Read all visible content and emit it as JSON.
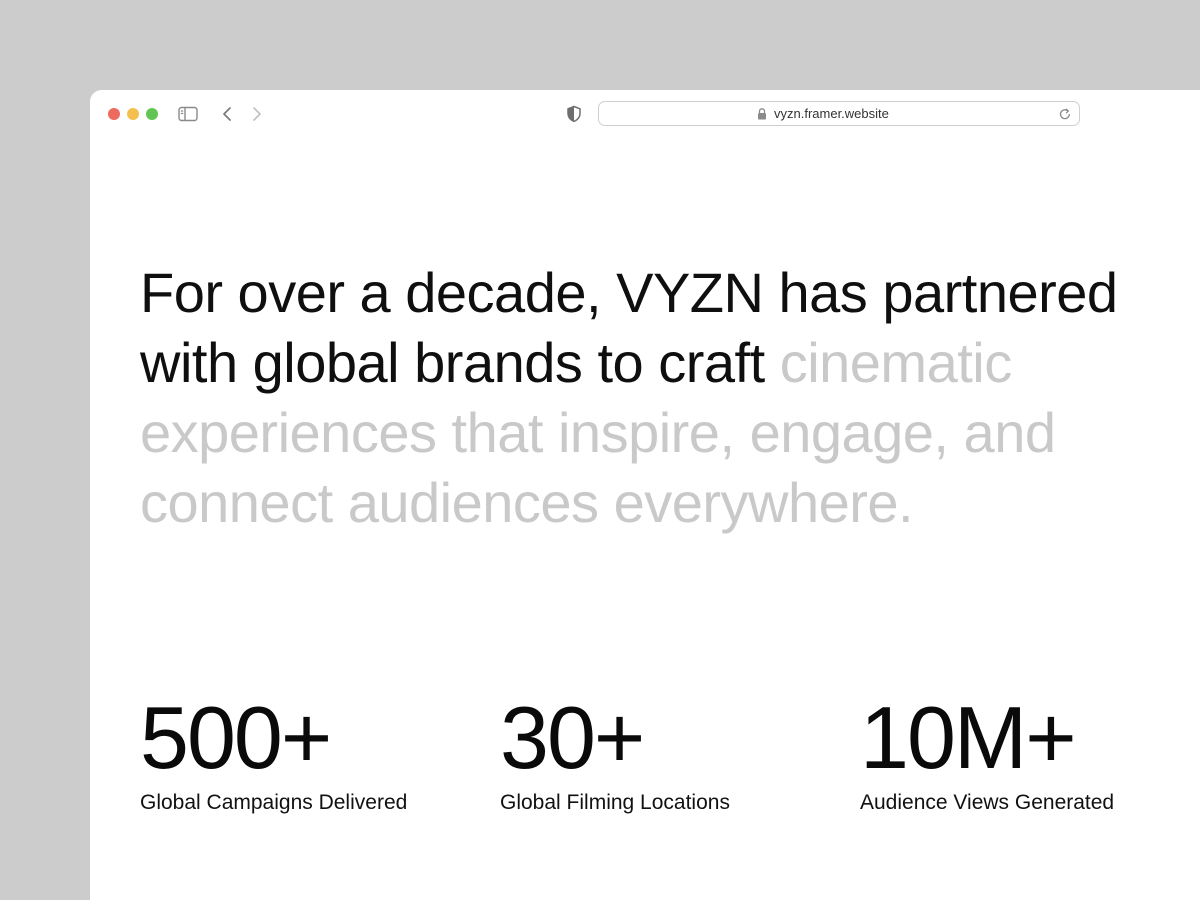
{
  "browser": {
    "url": "vyzn.framer.website",
    "traffic_lights": {
      "close": "#ed6a5e",
      "minimize": "#f4bf4f",
      "maximize": "#61c554"
    }
  },
  "headline": {
    "dark_text": "For over a decade, VYZN has partnered with global brands to craft",
    "muted_text": "cinematic experiences that inspire, engage, and connect audiences everywhere.",
    "dark_color": "#0f0f0f",
    "muted_color": "#c9c9c9"
  },
  "stats": [
    {
      "value": "500+",
      "label": "Global Campaigns Delivered"
    },
    {
      "value": "30+",
      "label": "Global Filming Locations"
    },
    {
      "value": "10M+",
      "label": "Audience Views Generated"
    }
  ],
  "icons": {
    "sidebar": "sidebar-icon",
    "back": "chevron-left-icon",
    "forward": "chevron-right-icon",
    "privacy": "shield-icon",
    "lock": "lock-icon",
    "reload": "reload-icon"
  }
}
